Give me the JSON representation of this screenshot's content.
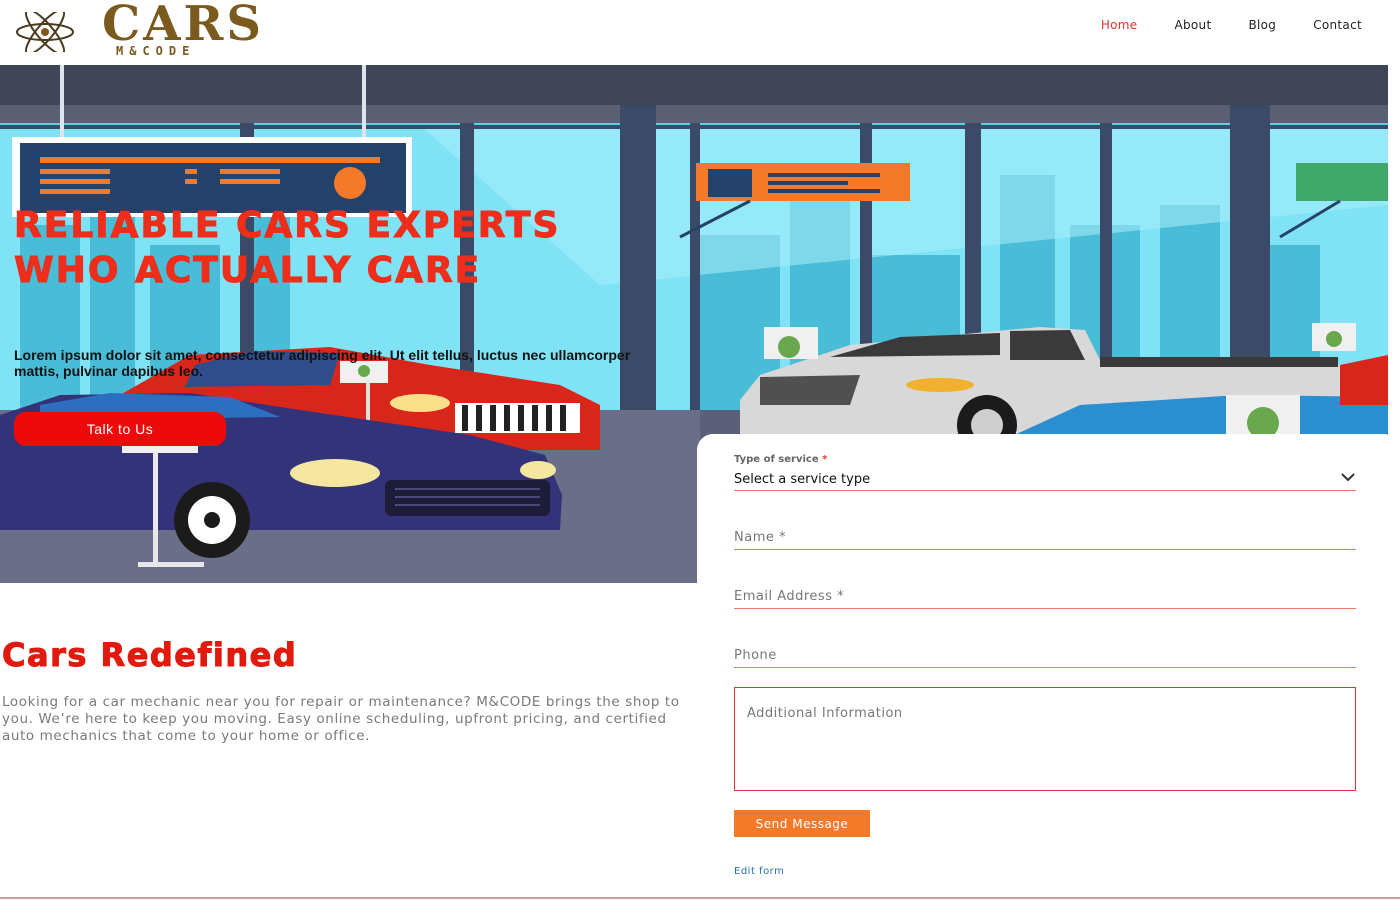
{
  "brand": {
    "name": "CARS",
    "sub": "M&CODE"
  },
  "nav": {
    "items": [
      "Home",
      "About",
      "Blog",
      "Contact"
    ],
    "active": "Home"
  },
  "hero": {
    "title": "RELIABLE CARS EXPERTS WHO ACTUALLY CARE",
    "subtitle": "Lorem ipsum dolor sit amet, consectetur adipiscing elit. Ut elit tellus, luctus nec ullamcorper mattis, pulvinar dapibus leo.",
    "cta": "Talk to Us"
  },
  "form": {
    "service_label": "Type of service",
    "required_mark": "*",
    "service_value": "Select a service type",
    "name_placeholder": "Name *",
    "email_placeholder": "Email Address *",
    "phone_placeholder": "Phone",
    "info_placeholder": "Additional Information",
    "submit": "Send Message",
    "edit_link": "Edit form"
  },
  "section": {
    "title": "Cars Redefined",
    "body": "Looking for a car mechanic near you for repair or maintenance? M&CODE brings the shop to you. We’re here to keep you moving. Easy online scheduling, upfront pricing, and certified auto mechanics that come to your home or office."
  },
  "colors": {
    "accent": "#ee2d1a",
    "button": "#f47a2a",
    "brand": "#7b5a1e",
    "link": "#2a6fb0"
  },
  "icons": {
    "logo": "atom-icon",
    "select": "chevron-down-icon"
  }
}
